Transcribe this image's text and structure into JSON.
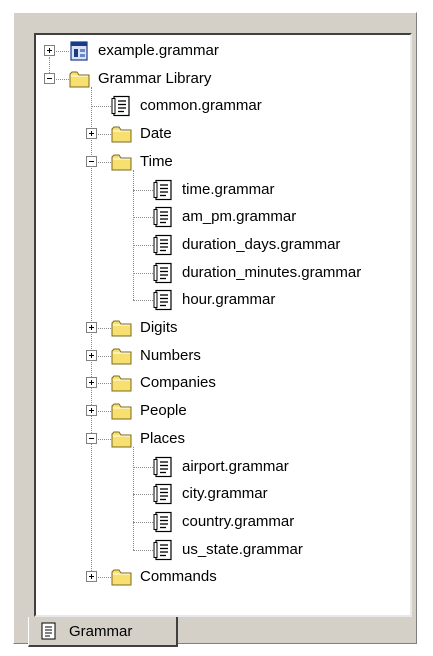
{
  "tree": [
    {
      "label": "example.grammar",
      "type": "project",
      "depth": 0,
      "expander": "plus"
    },
    {
      "label": "Grammar Library",
      "type": "folder",
      "depth": 0,
      "expander": "minus"
    },
    {
      "label": "common.grammar",
      "type": "file",
      "depth": 1
    },
    {
      "label": "Date",
      "type": "folder",
      "depth": 1,
      "expander": "plus"
    },
    {
      "label": "Time",
      "type": "folder",
      "depth": 1,
      "expander": "minus"
    },
    {
      "label": "time.grammar",
      "type": "file",
      "depth": 2
    },
    {
      "label": "am_pm.grammar",
      "type": "file",
      "depth": 2
    },
    {
      "label": "duration_days.grammar",
      "type": "file",
      "depth": 2
    },
    {
      "label": "duration_minutes.grammar",
      "type": "file",
      "depth": 2
    },
    {
      "label": "hour.grammar",
      "type": "file",
      "depth": 2
    },
    {
      "label": "Digits",
      "type": "folder",
      "depth": 1,
      "expander": "plus"
    },
    {
      "label": "Numbers",
      "type": "folder",
      "depth": 1,
      "expander": "plus"
    },
    {
      "label": "Companies",
      "type": "folder",
      "depth": 1,
      "expander": "plus"
    },
    {
      "label": "People",
      "type": "folder",
      "depth": 1,
      "expander": "plus"
    },
    {
      "label": "Places",
      "type": "folder",
      "depth": 1,
      "expander": "minus"
    },
    {
      "label": "airport.grammar",
      "type": "file",
      "depth": 2
    },
    {
      "label": "city.grammar",
      "type": "file",
      "depth": 2
    },
    {
      "label": "country.grammar",
      "type": "file",
      "depth": 2
    },
    {
      "label": "us_state.grammar",
      "type": "file",
      "depth": 2
    },
    {
      "label": "Commands",
      "type": "folder",
      "depth": 1,
      "expander": "plus"
    }
  ],
  "tab": {
    "label": "Grammar",
    "icon": "document-icon"
  },
  "colors": {
    "panel_bg": "#d4d0c8",
    "folder_yellow": "#f8e070",
    "tree_lines": "#8a8a8a"
  }
}
